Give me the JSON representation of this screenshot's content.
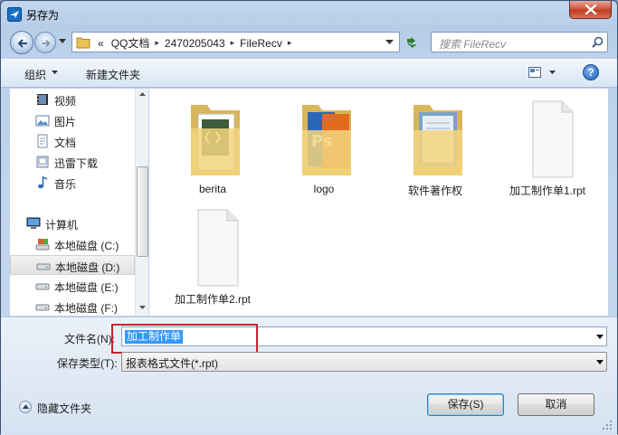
{
  "window": {
    "title": "另存为"
  },
  "address": {
    "crumbs": [
      "QQ文档",
      "2470205043",
      "FileRecv"
    ],
    "overflow": "«"
  },
  "search": {
    "placeholder": "搜索 FileRecv"
  },
  "toolbar": {
    "organize": "组织",
    "new_folder": "新建文件夹",
    "help": "?"
  },
  "navpane": {
    "items": [
      {
        "label": "视频",
        "icon": "video-library-icon"
      },
      {
        "label": "图片",
        "icon": "pictures-library-icon"
      },
      {
        "label": "文档",
        "icon": "documents-library-icon"
      },
      {
        "label": "迅雷下载",
        "icon": "download-library-icon"
      },
      {
        "label": "音乐",
        "icon": "music-library-icon"
      },
      {
        "label": "计算机",
        "icon": "computer-icon"
      },
      {
        "label": "本地磁盘 (C:)",
        "icon": "system-drive-icon"
      },
      {
        "label": "本地磁盘 (D:)",
        "icon": "drive-icon"
      },
      {
        "label": "本地磁盘 (E:)",
        "icon": "drive-icon"
      },
      {
        "label": "本地磁盘 (F:)",
        "icon": "drive-icon"
      }
    ],
    "selected": "本地磁盘 (D:)"
  },
  "files": [
    {
      "name": "berita",
      "type": "folder"
    },
    {
      "name": "logo",
      "type": "folder"
    },
    {
      "name": "软件著作权",
      "type": "folder"
    },
    {
      "name": "加工制作单1.rpt",
      "type": "file"
    },
    {
      "name": "加工制作单2.rpt",
      "type": "file"
    }
  ],
  "form": {
    "filename_label": "文件名(N):",
    "filename_value": "加工制作单",
    "filetype_label": "保存类型(T):",
    "filetype_value": "报表格式文件(*.rpt)"
  },
  "footer": {
    "hide_folders": "隐藏文件夹",
    "save": "保存(S)",
    "cancel": "取消"
  }
}
